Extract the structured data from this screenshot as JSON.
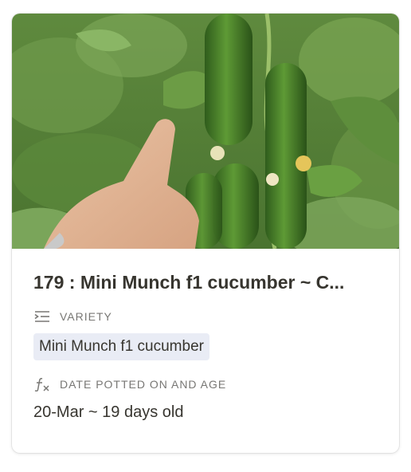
{
  "card": {
    "title": "179 : Mini Munch f1 cucumber ~ C...",
    "cover_image": "cucumber-plant-photo",
    "properties": {
      "variety": {
        "icon": "list-indent-icon",
        "label": "VARIETY",
        "value": "Mini Munch f1 cucumber"
      },
      "date_potted": {
        "icon": "formula-fx-icon",
        "label": "DATE POTTED ON AND AGE",
        "value": "20-Mar ~ 19 days old"
      }
    }
  },
  "colors": {
    "text": "#37352f",
    "muted": "#787774",
    "tag_bg": "#e9ecf5"
  }
}
